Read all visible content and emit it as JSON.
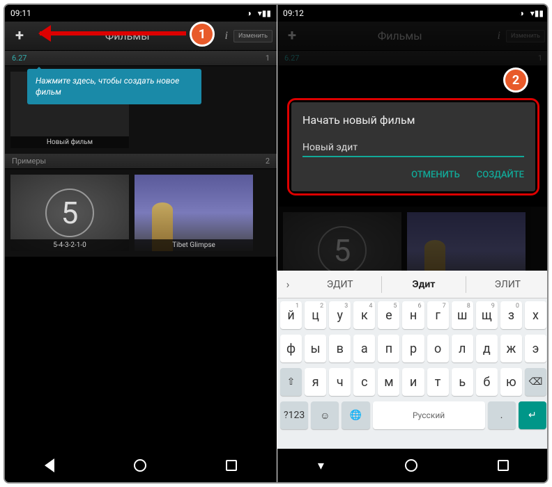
{
  "left": {
    "status_time": "09:11",
    "app_title": "Фильмы",
    "edit_btn": "Изменить",
    "date": "6.27",
    "count1": "1",
    "tooltip": "Нажмите здесь, чтобы создать новое фильм",
    "new_movie": "Новый фильм",
    "examples": "Примеры",
    "count2": "2",
    "ex1": "5-4-3-2-1-0",
    "ex2": "Tibet Glimpse",
    "countdown_num": "5",
    "marker": "1"
  },
  "right": {
    "status_time": "09:12",
    "app_title": "Фильмы",
    "edit_btn": "Изменить",
    "date": "6.27",
    "count1": "1",
    "marker": "2",
    "dialog_title": "Начать новый фильм",
    "dialog_input": "Новый эдит",
    "cancel": "ОТМЕНИТЬ",
    "create": "СОЗДАЙТЕ",
    "suggest": [
      "ЭДИТ",
      "Эдит",
      "ЭЛИТ"
    ],
    "row1": [
      "й",
      "ц",
      "у",
      "к",
      "е",
      "н",
      "г",
      "ш",
      "щ",
      "з",
      "х"
    ],
    "row1_nums": [
      "1",
      "2",
      "3",
      "4",
      "5",
      "6",
      "7",
      "8",
      "9",
      "0",
      ""
    ],
    "row2": [
      "ф",
      "ы",
      "в",
      "а",
      "п",
      "р",
      "о",
      "л",
      "д",
      "ж",
      "э"
    ],
    "row3": [
      "я",
      "ч",
      "с",
      "м",
      "и",
      "т",
      "ь",
      "б",
      "ю"
    ],
    "sym": "?123",
    "lang": "Русский"
  }
}
